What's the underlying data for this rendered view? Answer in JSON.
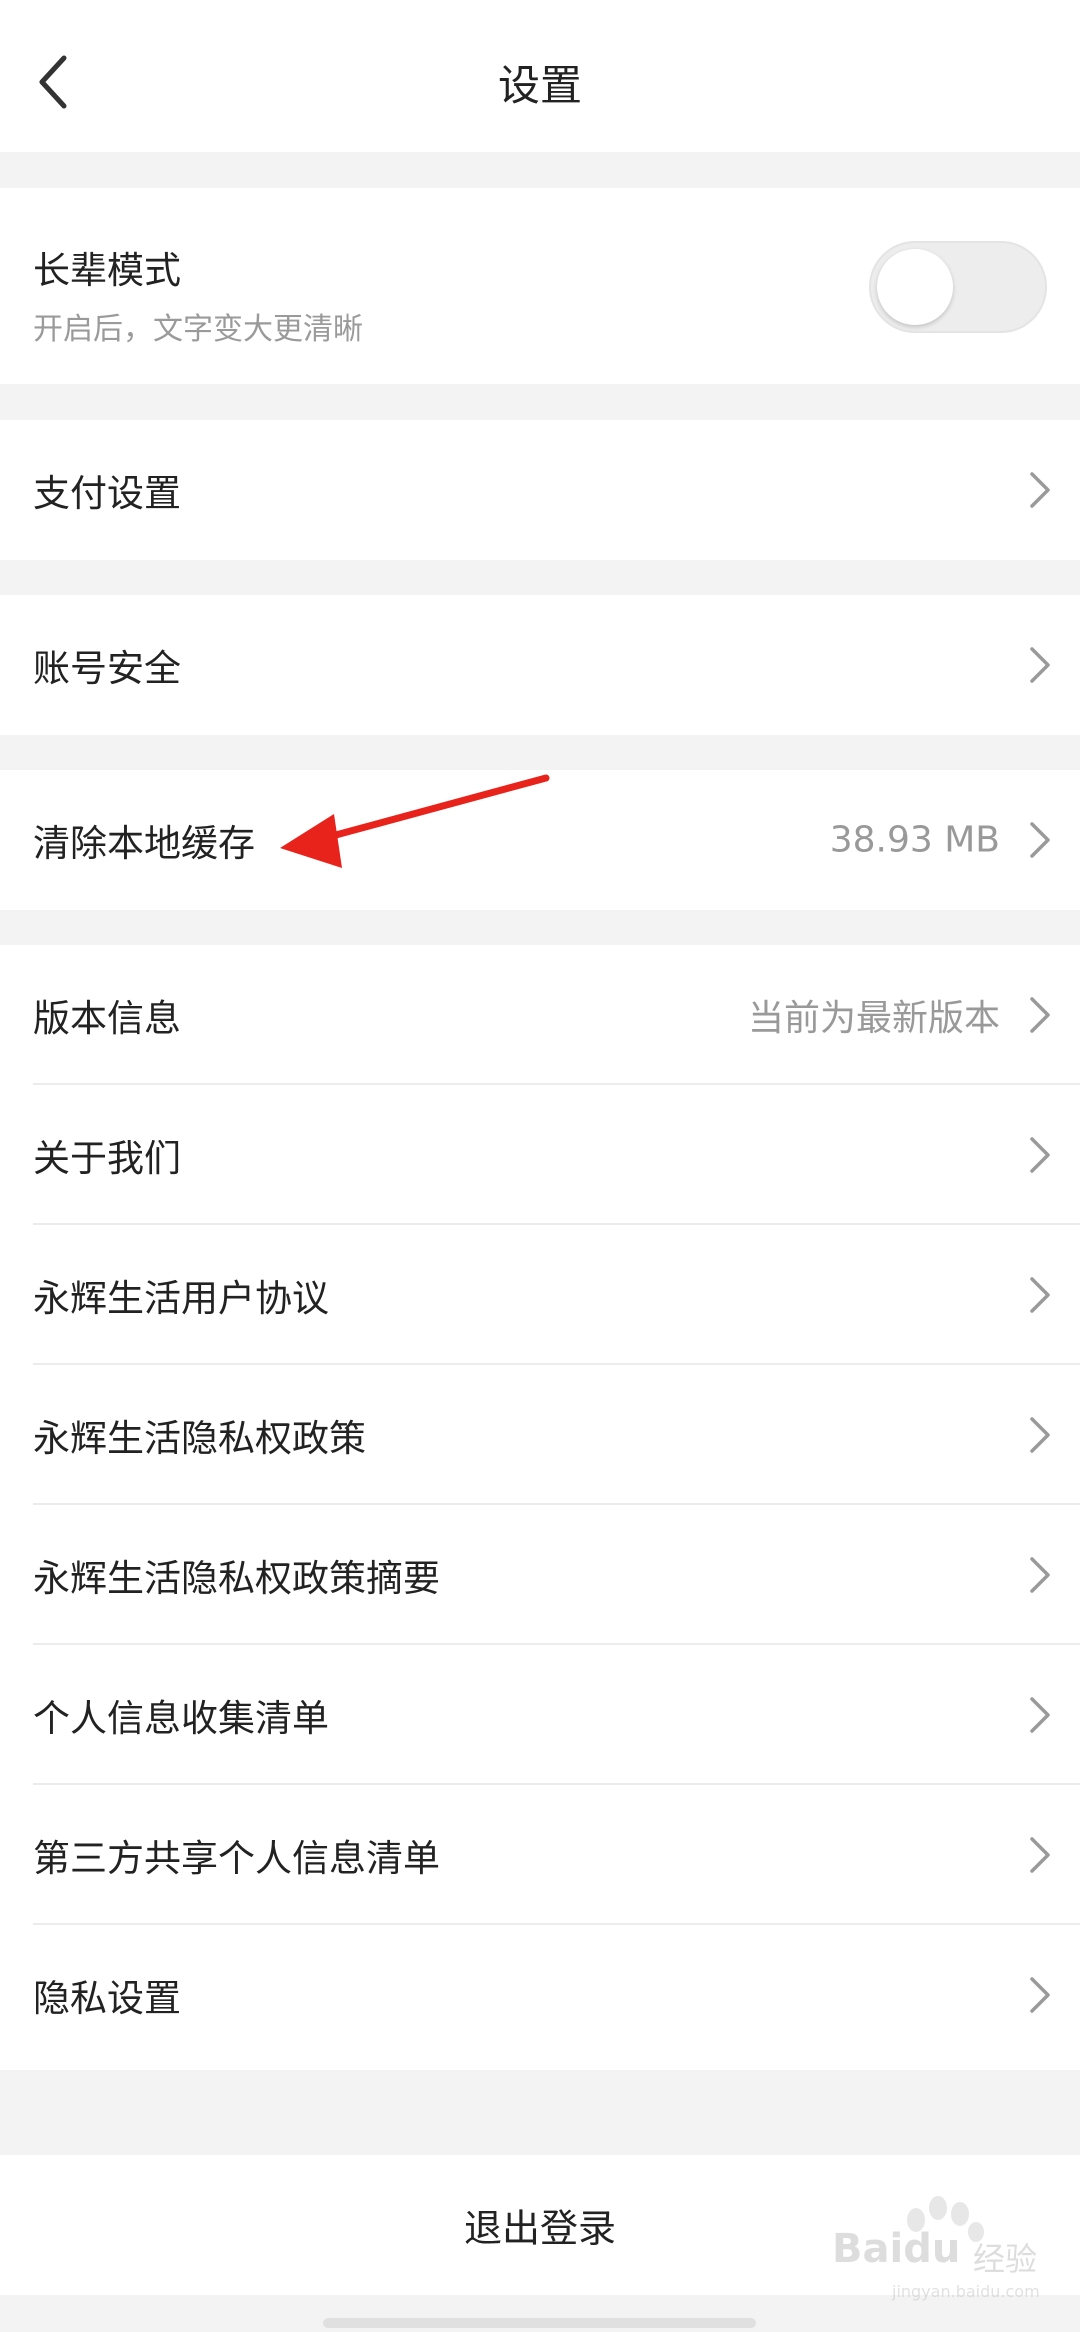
{
  "header": {
    "title": "设置"
  },
  "elder_mode": {
    "title": "长辈模式",
    "subtitle": "开启后，文字变大更清晰",
    "enabled": false
  },
  "payment": {
    "label": "支付设置"
  },
  "account": {
    "label": "账号安全"
  },
  "cache": {
    "label": "清除本地缓存",
    "value": "38.93 MB"
  },
  "info_list": [
    {
      "label": "版本信息",
      "value": "当前为最新版本"
    },
    {
      "label": "关于我们",
      "value": ""
    },
    {
      "label": "永辉生活用户协议",
      "value": ""
    },
    {
      "label": "永辉生活隐私权政策",
      "value": ""
    },
    {
      "label": "永辉生活隐私权政策摘要",
      "value": ""
    },
    {
      "label": "个人信息收集清单",
      "value": ""
    },
    {
      "label": "第三方共享个人信息清单",
      "value": ""
    },
    {
      "label": "隐私设置",
      "value": ""
    }
  ],
  "logout": {
    "label": "退出登录"
  },
  "watermark": {
    "brand": "Baidu",
    "brand_cn": "经验",
    "url": "jingyan.baidu.com"
  },
  "colors": {
    "page_bg": "#f3f3f3",
    "text": "#222222",
    "muted": "#999999",
    "annotation_arrow": "#e8231b"
  },
  "icons": {
    "back": "chevron-left-icon",
    "row_chevron": "chevron-right-icon"
  }
}
